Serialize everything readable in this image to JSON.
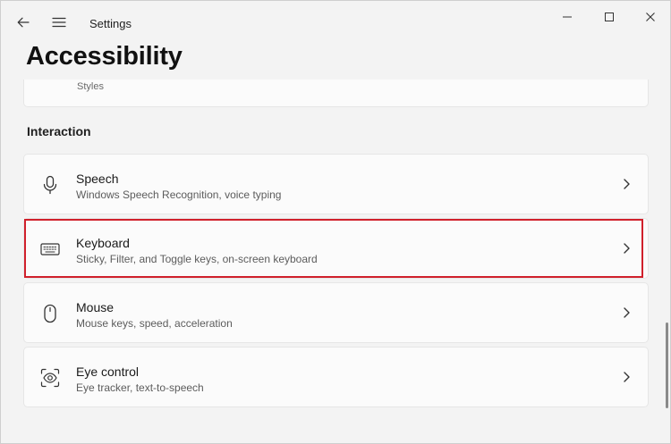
{
  "window": {
    "app_title": "Settings",
    "icons": {
      "back": "back-arrow-icon",
      "menu": "hamburger-menu-icon",
      "minimize": "minimize-icon",
      "maximize": "maximize-icon",
      "close": "close-icon"
    }
  },
  "page": {
    "title": "Accessibility",
    "partial_item_text": "Styles"
  },
  "interaction": {
    "heading": "Interaction",
    "items": [
      {
        "label": "Speech",
        "description": "Windows Speech Recognition, voice typing",
        "icon": "microphone-icon"
      },
      {
        "label": "Keyboard",
        "description": "Sticky, Filter, and Toggle keys, on-screen keyboard",
        "icon": "keyboard-icon",
        "highlighted": true
      },
      {
        "label": "Mouse",
        "description": "Mouse keys, speed, acceleration",
        "icon": "mouse-icon"
      },
      {
        "label": "Eye control",
        "description": "Eye tracker, text-to-speech",
        "icon": "eye-control-icon"
      }
    ]
  },
  "colors": {
    "background": "#f3f3f3",
    "card": "#fbfbfb",
    "highlight_border": "#d0202b"
  }
}
